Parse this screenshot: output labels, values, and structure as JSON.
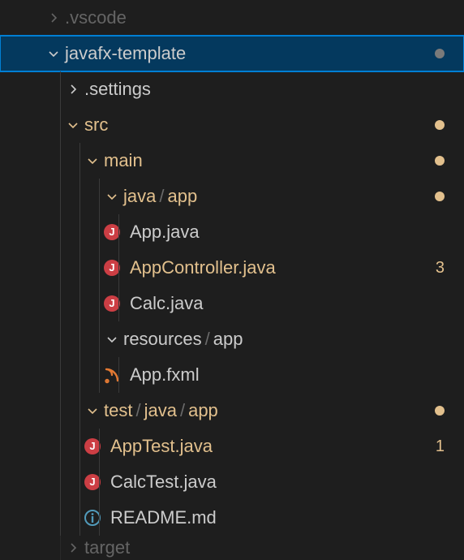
{
  "tree": {
    "vscode_label": ".vscode",
    "javafx_label": "javafx-template",
    "settings_label": ".settings",
    "src_label": "src",
    "main_label": "main",
    "java_seg": "java",
    "app_seg": "app",
    "app_java": "App.java",
    "appcontroller_java": "AppController.java",
    "appcontroller_badge": "3",
    "calc_java": "Calc.java",
    "resources_seg": "resources",
    "app_fxml": "App.fxml",
    "test_seg": "test",
    "apptest_java": "AppTest.java",
    "apptest_badge": "1",
    "calctest_java": "CalcTest.java",
    "readme_md": "README.md",
    "target_label": "target"
  },
  "colors": {
    "modified": "#e2c08d",
    "selected_bg": "#04395e",
    "selected_border": "#007fd4"
  }
}
